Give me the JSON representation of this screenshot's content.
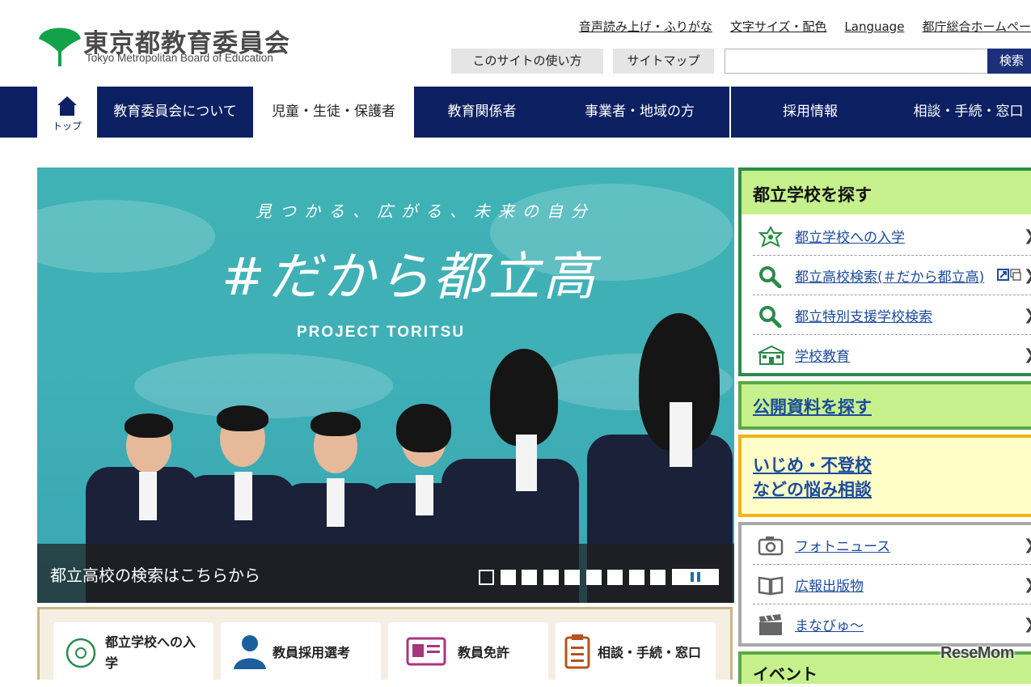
{
  "header": {
    "logo_ja": "東京都教育委員会",
    "logo_en": "Tokyo Metropolitan Board of Education",
    "util_links": [
      "音声読み上げ・ふりがな",
      "文字サイズ・配色",
      "Language",
      "都庁総合ホームペー"
    ],
    "sub_links": [
      "このサイトの使い方",
      "サイトマップ"
    ],
    "search": {
      "placeholder": "",
      "button": "検索"
    }
  },
  "nav": {
    "home_label": "トップ",
    "items": [
      "教育委員会について",
      "児童・生徒・保護者",
      "教育関係者",
      "事業者・地域の方",
      "採用情報",
      "相談・手続・窓口"
    ]
  },
  "hero": {
    "subtitle": "見つかる、広がる、未来の自分",
    "title": "#だから都立高",
    "en": "PROJECT TORITSU",
    "caption": "都立高校の検索はこちらから",
    "slide_count": 9,
    "current_slide": 1
  },
  "quick_links": [
    "都立学校への入学",
    "教員採用選考",
    "教員免許",
    "相談・手続・窓口"
  ],
  "school_panel": {
    "title": "都立学校を探す",
    "items": [
      {
        "label": "都立学校への入学",
        "icon": "sakura-icon"
      },
      {
        "label": "都立高校検索(＃だから都立高)",
        "icon": "magnifier-icon"
      },
      {
        "label": "都立特別支援学校検索",
        "icon": "magnifier-icon"
      },
      {
        "label": "学校教育",
        "icon": "school-icon"
      }
    ]
  },
  "public_docs": "公開資料を探す",
  "bullying": {
    "line1": "いじめ・不登校",
    "line2": "などの悩み相談"
  },
  "media_panel": {
    "items": [
      {
        "label": "フォトニュース",
        "icon": "camera-icon"
      },
      {
        "label": "広報出版物",
        "icon": "book-icon"
      },
      {
        "label": "まなびゅ〜",
        "icon": "clapper-icon"
      }
    ]
  },
  "event_panel": "イベント",
  "watermark": "ReseMom",
  "colors": {
    "nav": "#0d2062",
    "green_border": "#2b8a4b",
    "green_fill": "#c6f08c",
    "yellow_border": "#f0b414",
    "link": "#1c4b9c"
  }
}
